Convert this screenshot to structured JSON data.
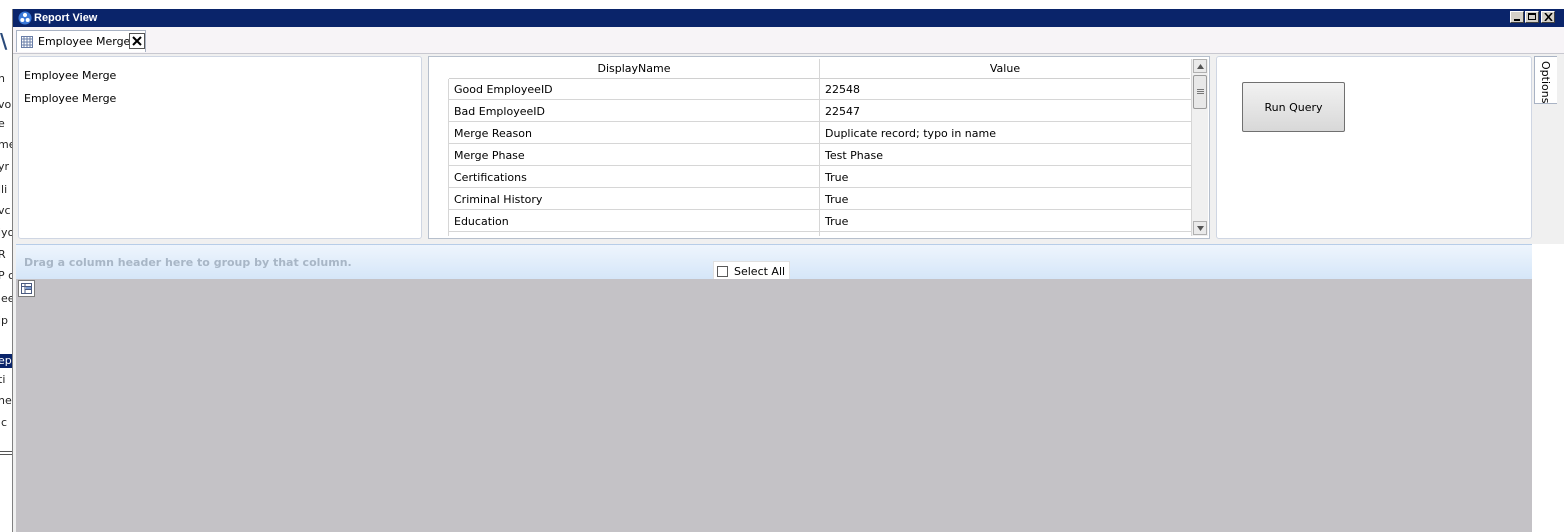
{
  "background_app": {
    "fragments": [
      "\\",
      "n",
      "vo",
      "e",
      "me",
      "yr",
      "lli",
      "vc",
      "iyo",
      "R",
      "P c",
      "'ee",
      "ip",
      "ep",
      "ti",
      "ne",
      "'c"
    ]
  },
  "window": {
    "title": "Report View",
    "title_bg": "#0a246a"
  },
  "tab": {
    "label": "Employee Merge"
  },
  "left_panel": {
    "items": [
      "Employee Merge",
      "Employee Merge"
    ]
  },
  "grid": {
    "columns": [
      "DisplayName",
      "Value"
    ],
    "rows": [
      {
        "name": "Good EmployeeID",
        "value": "22548"
      },
      {
        "name": "Bad EmployeeID",
        "value": "22547"
      },
      {
        "name": "Merge Reason",
        "value": "Duplicate record; typo in name"
      },
      {
        "name": "Merge Phase",
        "value": "Test Phase"
      },
      {
        "name": "Certifications",
        "value": "True"
      },
      {
        "name": "Criminal History",
        "value": "True"
      },
      {
        "name": "Education",
        "value": "True"
      }
    ]
  },
  "right_panel": {
    "run_query_label": "Run Query"
  },
  "options_tab": {
    "label": "Options"
  },
  "group_bar": {
    "hint": "Drag a column header here to group by that column."
  },
  "select_all": {
    "label": "Select All",
    "checked": false
  }
}
